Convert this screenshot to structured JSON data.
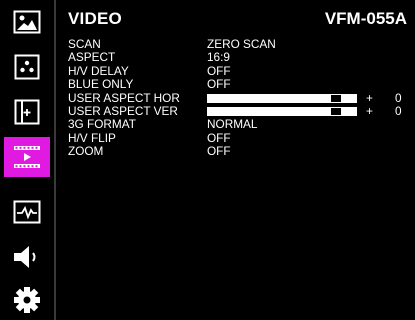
{
  "header": {
    "title": "VIDEO",
    "model": "VFM-055A"
  },
  "sidebar": {
    "tabs": [
      {
        "icon": "picture-icon"
      },
      {
        "icon": "dots-icon"
      },
      {
        "icon": "marker-frame-icon"
      },
      {
        "icon": "video-icon",
        "active": true
      },
      {
        "icon": "waveform-icon"
      },
      {
        "icon": "speaker-icon"
      },
      {
        "icon": "gear-icon"
      }
    ]
  },
  "menu": {
    "rows": [
      {
        "label": "SCAN",
        "value": "ZERO SCAN"
      },
      {
        "label": "ASPECT",
        "value": "16:9"
      },
      {
        "label": "H/V DELAY",
        "value": "OFF"
      },
      {
        "label": "BLUE ONLY",
        "value": "OFF"
      },
      {
        "label": "USER ASPECT HOR",
        "slider_fraction": 0.9,
        "sign": "+",
        "number": "0"
      },
      {
        "label": "USER ASPECT VER",
        "slider_fraction": 0.9,
        "sign": "+",
        "number": "0"
      },
      {
        "label": "3G FORMAT",
        "value": "NORMAL"
      },
      {
        "label": "H/V FLIP",
        "value": "OFF"
      },
      {
        "label": "ZOOM",
        "value": "OFF"
      }
    ]
  },
  "colors": {
    "active_tab": "#e01ae0",
    "background": "#000000",
    "text": "#ffffff"
  }
}
